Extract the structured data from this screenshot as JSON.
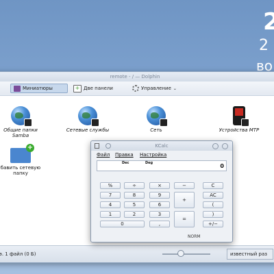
{
  "desktop": {
    "clock_big": "2",
    "clock_mid": "2",
    "clock_small": "во"
  },
  "dolphin": {
    "title": "remote - / — Dolphin",
    "toolbar": {
      "thumbnails_label": "Миниатюры",
      "add_panels_label": "Две панели",
      "manage_label": "Управление"
    },
    "items": [
      {
        "label": "Общие папки Samba",
        "icon": "network-globe-icon"
      },
      {
        "label": "Сетевые службы",
        "icon": "network-globe-icon"
      },
      {
        "label": "Сеть",
        "icon": "network-globe-icon"
      },
      {
        "label": "Устройства MTP",
        "icon": "media-player-icon"
      },
      {
        "label": "бавить сетевую папку",
        "icon": "add-folder-icon"
      }
    ],
    "status": {
      "text": "э. 1 файл (0 Б)",
      "free_space": "известный раз"
    }
  },
  "kcalc": {
    "title": "KCalc",
    "menu": [
      "Файл",
      "Правка",
      "Настройка"
    ],
    "display": {
      "mode_base": "Dec",
      "mode_angle": "Deg",
      "value": "0"
    },
    "keys": {
      "percent": "%",
      "divide": "÷",
      "multiply": "×",
      "minus": "−",
      "clear": "C",
      "seven": "7",
      "eight": "8",
      "nine": "9",
      "clear_all": "AC",
      "four": "4",
      "five": "5",
      "six": "6",
      "plus": "+",
      "open_paren": "(",
      "one": "1",
      "two": "2",
      "three": "3",
      "close_paren": ")",
      "zero": "0",
      "decimal": ",",
      "equals": "=",
      "plus_minus": "+/−"
    },
    "status": "NORM"
  }
}
